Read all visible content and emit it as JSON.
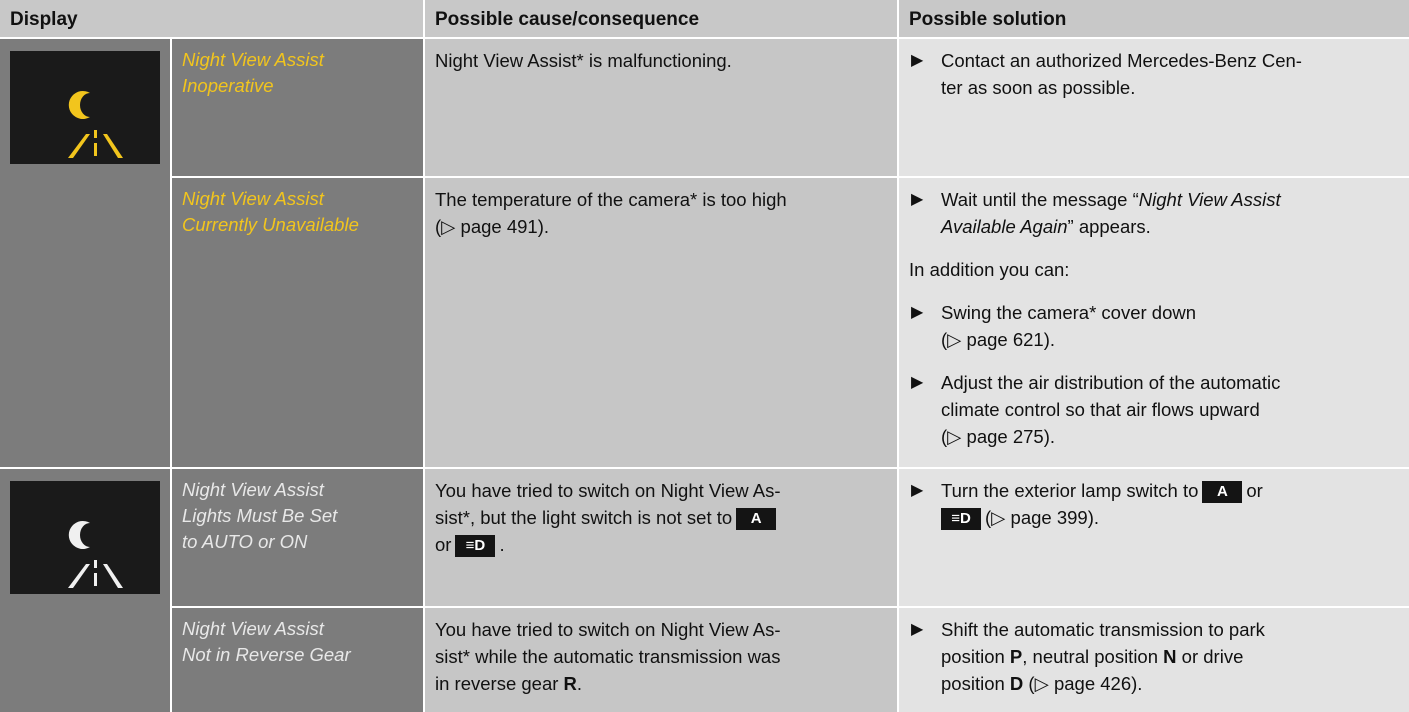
{
  "header": {
    "display": "Display",
    "cause": "Possible cause/consequence",
    "solution": "Possible solution"
  },
  "rows": [
    {
      "message": [
        "Night View Assist",
        "Inoperative"
      ],
      "cause": "Night View Assist* is malfunctioning.",
      "solution": {
        "bullet1_lines": [
          "Contact an authorized Mercedes-Benz Cen-",
          "ter as soon as possible."
        ]
      }
    },
    {
      "message": [
        "Night View Assist",
        "Currently Unavailable"
      ],
      "cause_line1": "The temperature of the camera* is too high",
      "cause_ref": "(▷ page 491).",
      "solution": {
        "bullet1_pre": "Wait until the message “",
        "bullet1_italic1": "Night View Assist",
        "bullet1_italic2": "Available Again",
        "bullet1_post": "” appears.",
        "addition": "In addition you can:",
        "bullet2_line1": "Swing the camera* cover down",
        "bullet2_ref": "(▷ page 621).",
        "bullet3_lines": [
          "Adjust the air distribution of the automatic",
          "climate control so that air flows upward"
        ],
        "bullet3_ref": "(▷ page 275)."
      }
    },
    {
      "message": [
        "Night View Assist",
        "Lights Must Be Set",
        "to AUTO or ON"
      ],
      "cause_line1": "You have tried to switch on Night View As-",
      "cause_line2": "sist*, but the light switch is not set to",
      "cause_or": "or",
      "key_a": "A",
      "key_low_beam": "≡D",
      "solution": {
        "bullet1_pre": "Turn the exterior lamp switch to",
        "bullet1_or": "or",
        "bullet1_ref": "(▷ page 399)."
      }
    },
    {
      "message": [
        "Night View Assist",
        "Not in Reverse Gear"
      ],
      "cause_lines": [
        "You have tried to switch on Night View As-",
        "sist* while the automatic transmission was"
      ],
      "cause_line3_pre": "in reverse gear",
      "gear_r": "R",
      "solution": {
        "line1": "Shift the automatic transmission to park",
        "line2_pre": "position",
        "gear_p": "P",
        "line2_mid": ", neutral position",
        "gear_n": "N",
        "line2_post": " or drive",
        "line3_pre": "position",
        "gear_d": "D",
        "line3_ref": "(▷ page 426)."
      }
    }
  ],
  "icons": [
    "night-view-icon-yellow",
    "night-view-icon-white"
  ],
  "colors": {
    "display_bg": "#7c7c7c",
    "cause_bg": "#c6c6c6",
    "solution_bg": "#e3e3e3",
    "header_bg": "#c8c8c8",
    "warning_yellow": "#f2c51d"
  }
}
